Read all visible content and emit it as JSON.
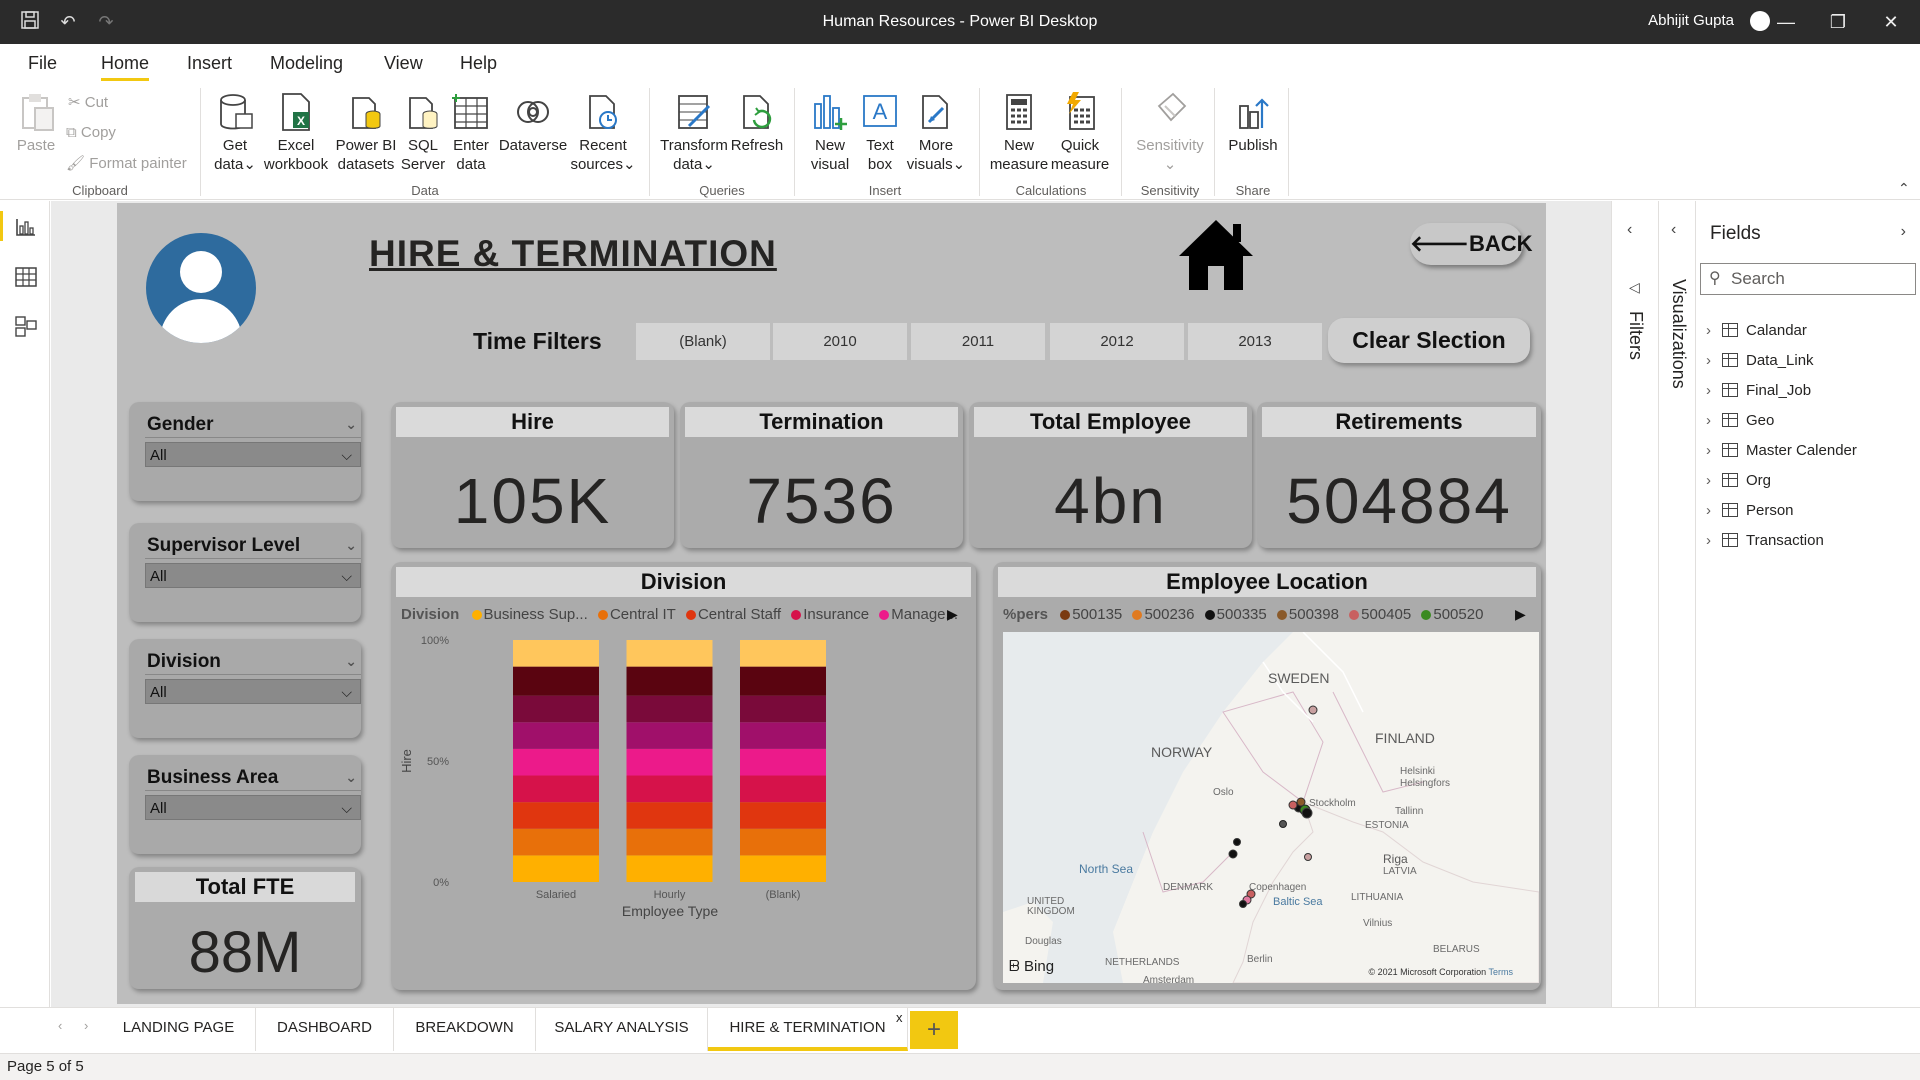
{
  "window": {
    "title": "Human Resources - Power BI Desktop",
    "user": "Abhijit Gupta"
  },
  "menu": [
    "File",
    "Home",
    "Insert",
    "Modeling",
    "View",
    "Help"
  ],
  "ribbon": {
    "clipboard": {
      "paste": "Paste",
      "cut": "Cut",
      "copy": "Copy",
      "format_painter": "Format painter",
      "group": "Clipboard"
    },
    "data": {
      "get_data": [
        "Get",
        "data"
      ],
      "excel": [
        "Excel",
        "workbook"
      ],
      "pbi": [
        "Power BI",
        "datasets"
      ],
      "sql": [
        "SQL",
        "Server"
      ],
      "enter": [
        "Enter",
        "data"
      ],
      "dataverse": "Dataverse",
      "recent": [
        "Recent",
        "sources"
      ],
      "group": "Data"
    },
    "queries": {
      "transform": [
        "Transform",
        "data"
      ],
      "refresh": "Refresh",
      "group": "Queries"
    },
    "insert": {
      "new_visual": [
        "New",
        "visual"
      ],
      "text_box": [
        "Text",
        "box"
      ],
      "more": [
        "More",
        "visuals"
      ],
      "group": "Insert"
    },
    "calc": {
      "new_measure": [
        "New",
        "measure"
      ],
      "quick": [
        "Quick",
        "measure"
      ],
      "group": "Calculations"
    },
    "sens": {
      "label": "Sensitivity",
      "group": "Sensitivity"
    },
    "share": {
      "publish": "Publish",
      "group": "Share"
    }
  },
  "report": {
    "title": "HIRE & TERMINATION",
    "back": "BACK",
    "time_filters": {
      "label": "Time Filters",
      "options": [
        "(Blank)",
        "2010",
        "2011",
        "2012",
        "2013"
      ]
    },
    "clear": "Clear Slection",
    "slicers": [
      {
        "title": "Gender",
        "value": "All"
      },
      {
        "title": "Supervisor Level",
        "value": "All"
      },
      {
        "title": "Division",
        "value": "All"
      },
      {
        "title": "Business Area",
        "value": "All"
      }
    ],
    "fte": {
      "title": "Total FTE",
      "value": "88M"
    },
    "kpis": [
      {
        "title": "Hire",
        "value": "105K"
      },
      {
        "title": "Termination",
        "value": "7536"
      },
      {
        "title": "Total Employee",
        "value": "4bn"
      },
      {
        "title": "Retirements",
        "value": "504884"
      }
    ],
    "division_chart": {
      "title": "Division",
      "legend_title": "Division",
      "legend": [
        {
          "name": "Business Sup...",
          "color": "#ffb000"
        },
        {
          "name": "Central IT",
          "color": "#e8700a"
        },
        {
          "name": "Central Staff",
          "color": "#e0360f"
        },
        {
          "name": "Insurance",
          "color": "#d6124a"
        },
        {
          "name": "Manage...",
          "color": "#ec1a8a"
        }
      ]
    },
    "map": {
      "title": "Employee Location",
      "legend_title": "%pers",
      "legend": [
        {
          "name": "500135",
          "color": "#7a3a10"
        },
        {
          "name": "500236",
          "color": "#e07a20"
        },
        {
          "name": "500335",
          "color": "#111111"
        },
        {
          "name": "500398",
          "color": "#8a5a2a"
        },
        {
          "name": "500405",
          "color": "#c86060"
        },
        {
          "name": "500520",
          "color": "#3a8a20"
        }
      ],
      "labels": [
        "SWEDEN",
        "FINLAND",
        "NORWAY",
        "Oslo",
        "Stockholm",
        "Helsinki",
        "Helsingfors",
        "Tallinn",
        "ESTONIA",
        "North Sea",
        "Riga",
        "LATVIA",
        "DENMARK",
        "Copenhagen",
        "Baltic Sea",
        "LITHUANIA",
        "UNITED",
        "KINGDOM",
        "Vilnius",
        "Douglas",
        "NETHERLANDS",
        "Berlin",
        "BELARUS",
        "Amsterdam"
      ],
      "bing": "Bing",
      "copyright": "© 2021 Microsoft Corporation",
      "terms": "Terms"
    }
  },
  "chart_data": {
    "type": "bar",
    "stacked": "100%",
    "title": "Division",
    "xlabel": "Employee Type",
    "ylabel": "Hire",
    "categories": [
      "Salaried",
      "Hourly",
      "(Blank)"
    ],
    "yticks": [
      "100%",
      "50%",
      "0%"
    ],
    "ylim": [
      0,
      100
    ],
    "series": [
      {
        "color": "#ffb000",
        "values": [
          11,
          11,
          11
        ]
      },
      {
        "color": "#e8700a",
        "values": [
          11,
          11,
          11
        ]
      },
      {
        "color": "#e0360f",
        "values": [
          11,
          11,
          11
        ]
      },
      {
        "color": "#d6124a",
        "values": [
          11,
          11,
          11
        ]
      },
      {
        "color": "#ec1a8a",
        "values": [
          11,
          11,
          11
        ]
      },
      {
        "color": "#a0106a",
        "values": [
          11,
          11,
          11
        ]
      },
      {
        "color": "#7a0a3a",
        "values": [
          11,
          11,
          11
        ]
      },
      {
        "color": "#5a0410",
        "values": [
          12,
          12,
          12
        ]
      },
      {
        "color": "#ffc65c",
        "values": [
          11,
          11,
          11
        ]
      }
    ]
  },
  "fields": {
    "title": "Fields",
    "search_placeholder": "Search",
    "items": [
      "Calandar",
      "Data_Link",
      "Final_Job",
      "Geo",
      "Master Calender",
      "Org",
      "Person",
      "Transaction"
    ]
  },
  "side": {
    "filters": "Filters",
    "visualizations": "Visualizations"
  },
  "tabs": [
    "LANDING PAGE",
    "DASHBOARD",
    "BREAKDOWN",
    "SALARY ANALYSIS",
    "HIRE & TERMINATION"
  ],
  "status": "Page 5 of 5"
}
